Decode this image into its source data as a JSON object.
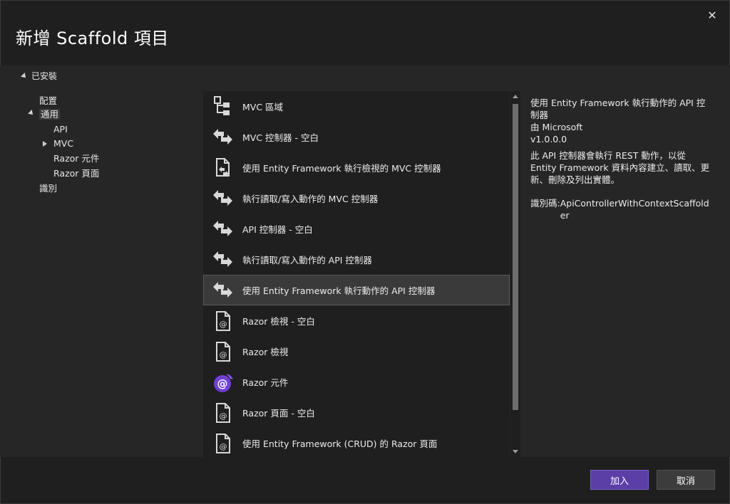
{
  "dialog": {
    "title": "新增 Scaffold 項目",
    "close_icon": "close-icon"
  },
  "installed": {
    "label": "已安裝"
  },
  "tree": {
    "items": [
      {
        "label": "配置"
      },
      {
        "label": "通用"
      },
      {
        "label": "API"
      },
      {
        "label": "MVC"
      },
      {
        "label": "Razor 元件"
      },
      {
        "label": "Razor 頁面"
      },
      {
        "label": "識別"
      }
    ]
  },
  "templates": [
    {
      "label": "MVC 區域",
      "icon": "area-tree-icon"
    },
    {
      "label": "MVC 控制器 - 空白",
      "icon": "controller-icon"
    },
    {
      "label": "使用 Entity Framework 執行檢視的 MVC 控制器",
      "icon": "controller-views-icon"
    },
    {
      "label": "執行讀取/寫入動作的 MVC 控制器",
      "icon": "controller-icon"
    },
    {
      "label": "API 控制器 - 空白",
      "icon": "controller-icon"
    },
    {
      "label": "執行讀取/寫入動作的 API 控制器",
      "icon": "controller-icon"
    },
    {
      "label": "使用 Entity Framework 執行動作的 API 控制器",
      "icon": "controller-icon"
    },
    {
      "label": "Razor 檢視 - 空白",
      "icon": "razor-file-icon"
    },
    {
      "label": "Razor 檢視",
      "icon": "razor-file-icon"
    },
    {
      "label": "Razor 元件",
      "icon": "blazor-icon"
    },
    {
      "label": "Razor 頁面 - 空白",
      "icon": "razor-file-icon"
    },
    {
      "label": "使用 Entity Framework (CRUD) 的 Razor 頁面",
      "icon": "razor-file-icon"
    }
  ],
  "selected_index": 6,
  "detail": {
    "title": "使用 Entity Framework 執行動作的 API 控制器",
    "author": "由 Microsoft",
    "version": "v1.0.0.0",
    "description": "此 API 控制器會執行 REST 動作，以從 Entity Framework 資料內容建立、讀取、更新、刪除及列出實體。",
    "id_label": "識別碼:",
    "id_value": "ApiControllerWithContextScaffolder"
  },
  "buttons": {
    "add": "加入",
    "cancel": "取消"
  },
  "colors": {
    "accent": "#5b3fa6",
    "selection": "#3a3a3a",
    "blazor": "#6f3fd6"
  }
}
